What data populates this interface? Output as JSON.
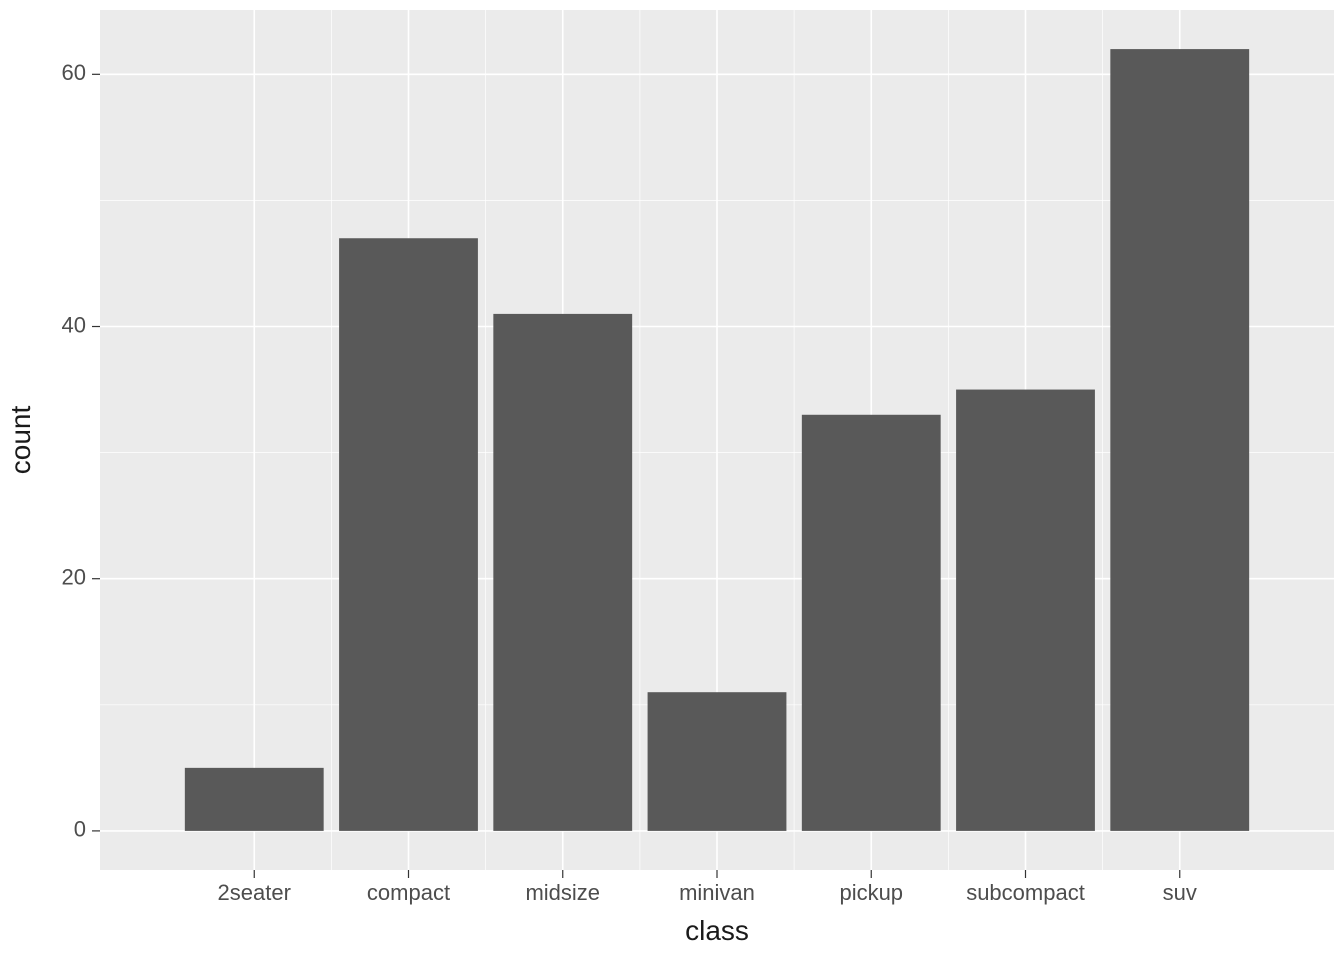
{
  "chart_data": {
    "type": "bar",
    "categories": [
      "2seater",
      "compact",
      "midsize",
      "minivan",
      "pickup",
      "subcompact",
      "suv"
    ],
    "values": [
      5,
      47,
      41,
      11,
      33,
      35,
      62
    ],
    "xlabel": "class",
    "ylabel": "count",
    "title": "",
    "ylim": [
      0,
      65
    ],
    "y_ticks": [
      0,
      20,
      40,
      60
    ],
    "bar_fill": "#595959",
    "panel_bg": "#ebebeb"
  }
}
